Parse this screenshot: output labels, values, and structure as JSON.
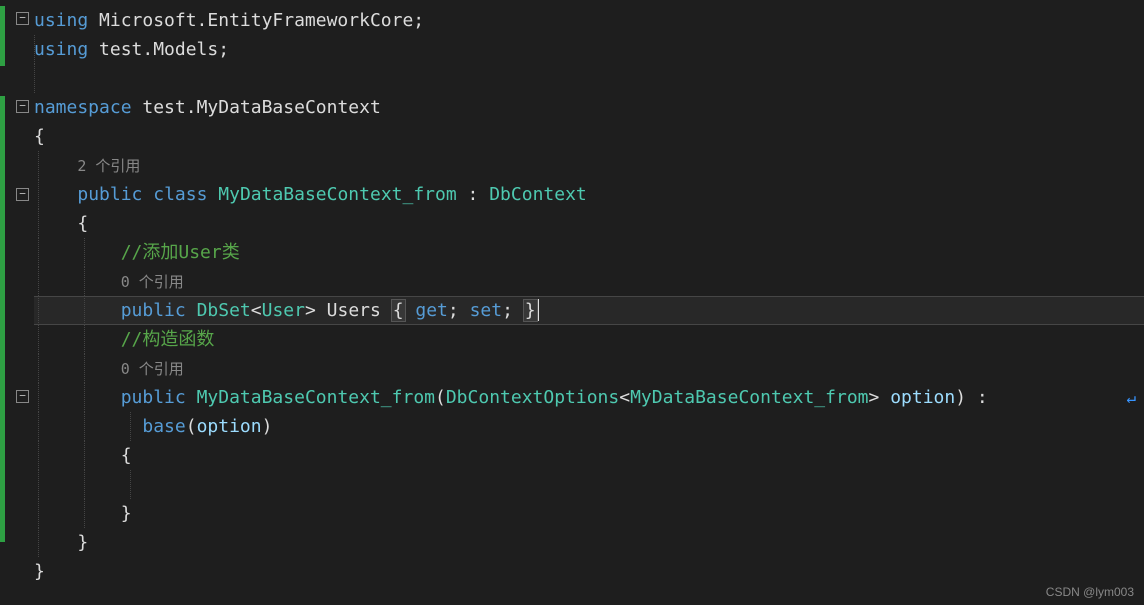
{
  "folds": [
    "−",
    "−",
    "−",
    "−"
  ],
  "code": {
    "l1": {
      "kw": "using",
      "ns": " Microsoft.EntityFrameworkCore;"
    },
    "l2": {
      "kw": "using",
      "ns": " test.Models;"
    },
    "l4": {
      "kw": "namespace",
      "ns": " test.MyDataBaseContext"
    },
    "l5": "{",
    "l6_lens": "2 个引用",
    "l7": {
      "pub": "public",
      "cls": "class",
      "name": "MyDataBaseContext_from",
      "colon": ":",
      "base": "DbContext"
    },
    "l8": "{",
    "l9": "//添加User类",
    "l10_lens": "0 个引用",
    "l11": {
      "pub": "public",
      "dbset": "DbSet",
      "lt": "<",
      "user": "User",
      "gt": ">",
      "prop": "Users",
      "ob": "{",
      "get": "get",
      "sc1": ";",
      "set": "set",
      "sc2": ";",
      "cb": "}"
    },
    "l12": "//构造函数",
    "l13_lens": "0 个引用",
    "l14": {
      "pub": "public",
      "name": "MyDataBaseContext_from",
      "op": "(",
      "opt": "DbContextOptions",
      "lt": "<",
      "inner": "MyDataBaseContext_from",
      "gt": ">",
      "param": "option",
      "cp": ")",
      "colon": ":"
    },
    "l15": {
      "base": "base",
      "op": "(",
      "param": "option",
      "cp": ")"
    },
    "l16": "{",
    "l18": "}",
    "l19": "}",
    "l20": "}"
  },
  "watermark": "CSDN @lym003"
}
